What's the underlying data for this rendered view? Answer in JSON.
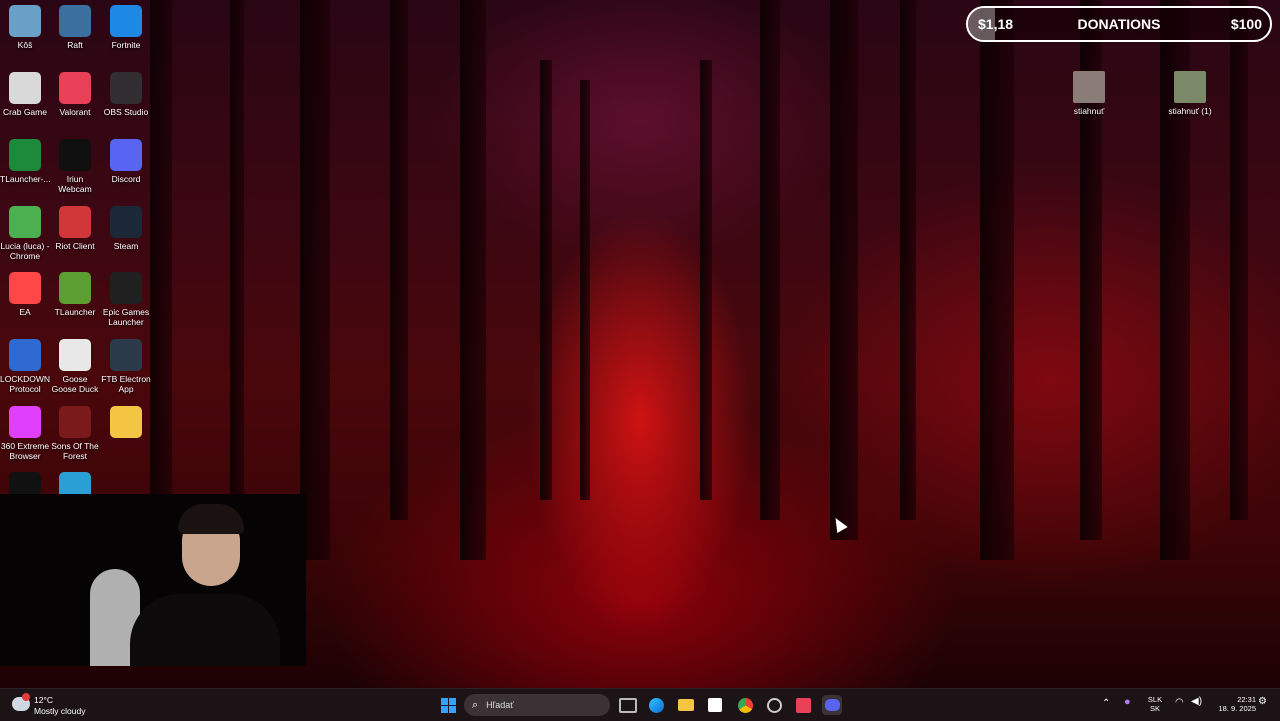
{
  "desktop_icons": [
    {
      "label": "Kôš",
      "icon": "recycle-bin-icon",
      "color": "#6aa0c8"
    },
    {
      "label": "Raft",
      "icon": "raft-icon",
      "color": "#3b6fa0"
    },
    {
      "label": "Fortnite",
      "icon": "fortnite-icon",
      "color": "#1e88e5"
    },
    {
      "label": "Crab Game",
      "icon": "crab-game-icon",
      "color": "#d9d9d9"
    },
    {
      "label": "Valorant",
      "icon": "valorant-icon",
      "color": "#e84057"
    },
    {
      "label": "OBS Studio",
      "icon": "obs-icon",
      "color": "#302e31"
    },
    {
      "label": "TLauncher-...",
      "icon": "tlauncher-icon",
      "color": "#1c8a3a"
    },
    {
      "label": "Iriun Webcam",
      "icon": "iriun-webcam-icon",
      "color": "#101010"
    },
    {
      "label": "Discord",
      "icon": "discord-icon",
      "color": "#5865f2"
    },
    {
      "label": "Lucia (luca) - Chrome",
      "icon": "chrome-icon",
      "color": "#4caf50"
    },
    {
      "label": "Riot Client",
      "icon": "riot-client-icon",
      "color": "#d13639"
    },
    {
      "label": "Steam",
      "icon": "steam-icon",
      "color": "#1b2838"
    },
    {
      "label": "EA",
      "icon": "ea-icon",
      "color": "#ff4747"
    },
    {
      "label": "TLauncher",
      "icon": "minecraft-grass-icon",
      "color": "#5c9e31"
    },
    {
      "label": "Epic Games Launcher",
      "icon": "epic-games-icon",
      "color": "#202020"
    },
    {
      "label": "LOCKDOWN Protocol",
      "icon": "lockdown-protocol-icon",
      "color": "#2f6ad0"
    },
    {
      "label": "Goose Goose Duck",
      "icon": "goose-icon",
      "color": "#e8e8e8"
    },
    {
      "label": "FTB Electron App",
      "icon": "ftb-icon",
      "color": "#2a3a4a"
    },
    {
      "label": "360 Extreme Browser",
      "icon": "360-browser-icon",
      "color": "#e040fb"
    },
    {
      "label": "Sons Of The Forest",
      "icon": "sons-of-the-forest-icon",
      "color": "#7a1a1a"
    },
    {
      "label": "",
      "icon": "game-face-icon",
      "color": "#f4c542"
    },
    {
      "label": "",
      "icon": "logitech-g-icon",
      "color": "#111111"
    },
    {
      "label": "",
      "icon": "game-launcher-icon",
      "color": "#2a9fd6"
    }
  ],
  "right_icons": [
    {
      "label": "stiahnuť",
      "icon": "photo-file-icon"
    },
    {
      "label": "stiahnuť (1)",
      "icon": "photo-file-icon"
    }
  ],
  "donations": {
    "current": "$1,18",
    "title": "DONATIONS",
    "goal": "$100",
    "progress_fraction": 0.09
  },
  "taskbar": {
    "weather_temp": "12°C",
    "weather_text": "Mostly cloudy",
    "search_placeholder": "Hľadať",
    "lang_top": "SLK",
    "lang_bottom": "SK",
    "time": "22:31",
    "date": "18. 9. 2025"
  },
  "colors": {
    "accent_red": "#c0121a",
    "taskbar_bg": "#1b1316"
  }
}
